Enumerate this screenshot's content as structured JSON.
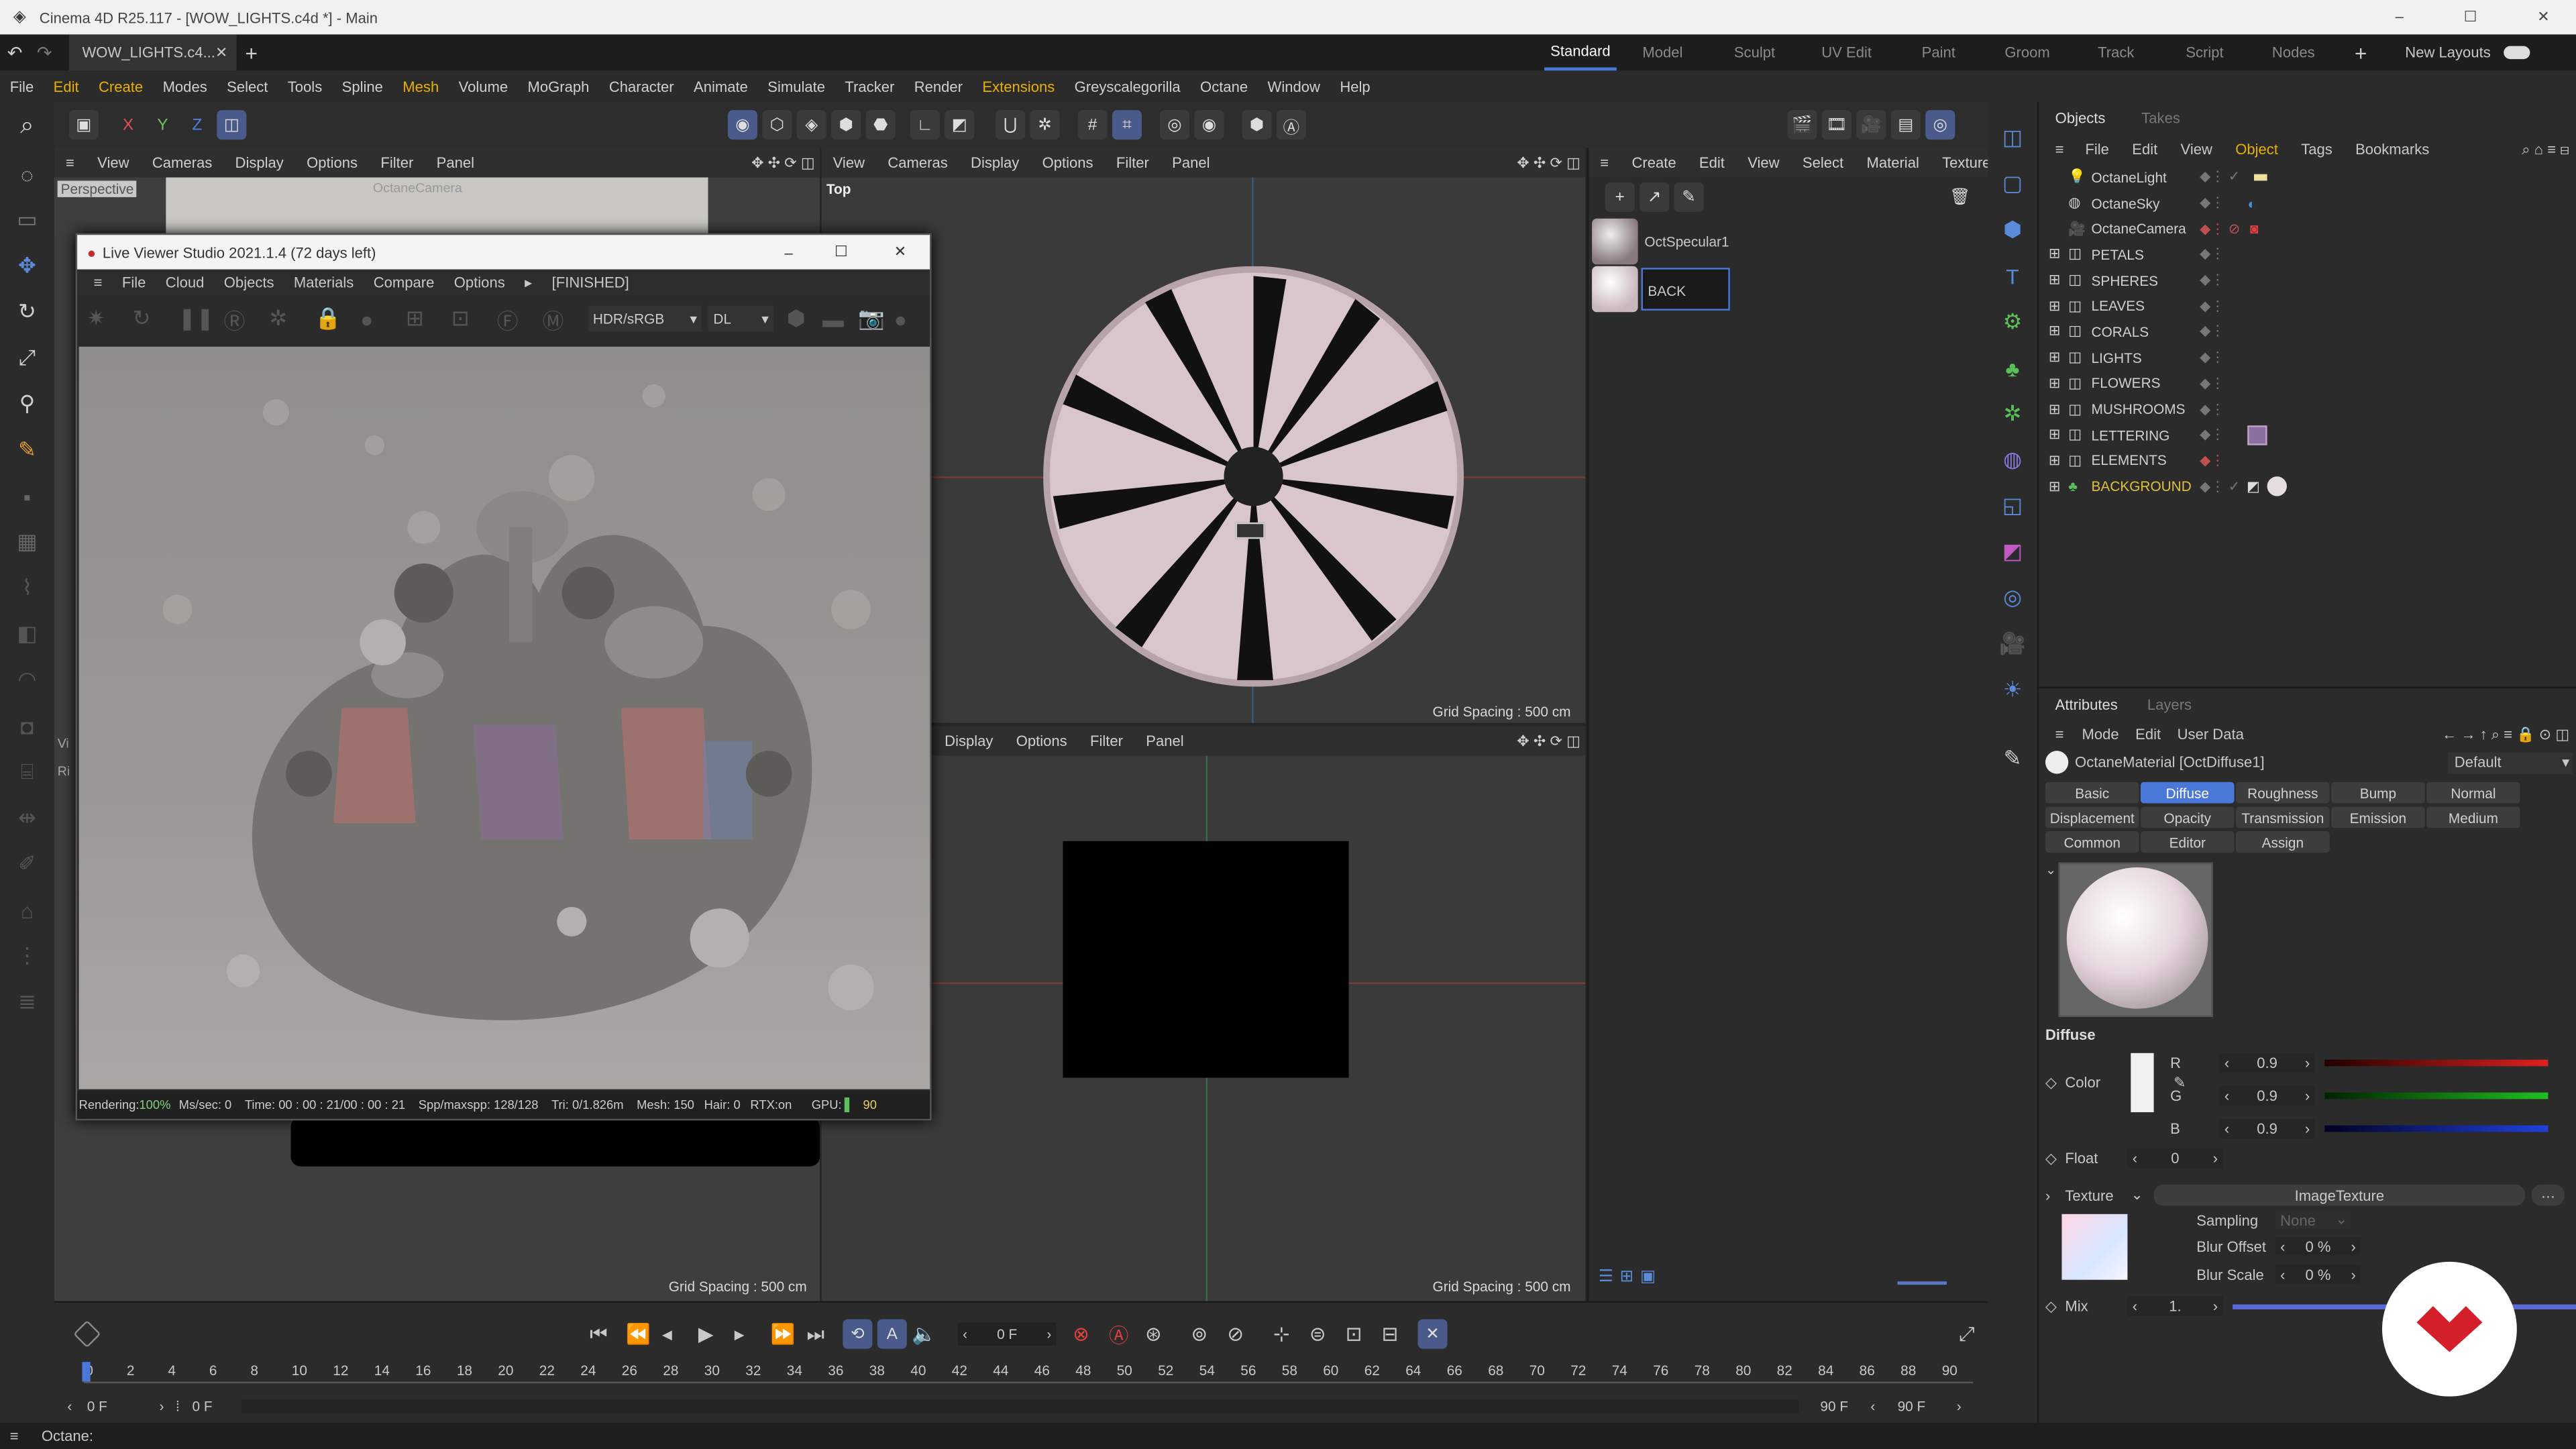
{
  "window": {
    "title": "Cinema 4D R25.117 - [WOW_LIGHTS.c4d *] - Main"
  },
  "tabs": {
    "doc_tab": "WOW_LIGHTS.c4...",
    "layouts": [
      "Standard",
      "Model",
      "Sculpt",
      "UV Edit",
      "Paint",
      "Groom",
      "Track",
      "Script",
      "Nodes"
    ],
    "new_layouts": "New Layouts"
  },
  "menu": [
    "File",
    "Edit",
    "Create",
    "Modes",
    "Select",
    "Tools",
    "Spline",
    "Mesh",
    "Volume",
    "MoGraph",
    "Character",
    "Animate",
    "Simulate",
    "Tracker",
    "Render",
    "Extensions",
    "Greyscalegorilla",
    "Octane",
    "Window",
    "Help"
  ],
  "coords": {
    "x": "X",
    "y": "Y",
    "z": "Z"
  },
  "viewport_menu": [
    "View",
    "Cameras",
    "Display",
    "Options",
    "Filter",
    "Panel"
  ],
  "viewport_tl": {
    "name": "Perspective",
    "camera": "OctaneCamera"
  },
  "viewport_tr": {
    "name": "Top",
    "grid": "Grid Spacing : 500 cm"
  },
  "viewport_br": {
    "menu": [
      "Display",
      "Options",
      "Filter",
      "Panel"
    ],
    "grid": "Grid Spacing : 500 cm"
  },
  "viewport_bl": {
    "label_vi": "Vi",
    "label_ri": "Ri",
    "grid": "Grid Spacing : 500 cm"
  },
  "live_viewer": {
    "title": "Live Viewer Studio 2021.1.4 (72 days left)",
    "menu": [
      "File",
      "Cloud",
      "Objects",
      "Materials",
      "Compare",
      "Options"
    ],
    "state": "[FINISHED]",
    "colorspace": "HDR/sRGB",
    "kernel": "DL",
    "status": {
      "rendering": "Rendering: ",
      "rendering_val": "100%",
      "mssec": "Ms/sec: 0",
      "time": "Time: 00 : 00 : 21/00 : 00 : 21",
      "spp": "Spp/maxspp: 128/128",
      "tri": "Tri: 0/1.826m",
      "mesh": "Mesh: 150",
      "hair": "Hair: 0",
      "rtx": "RTX:on",
      "gpu": "GPU:",
      "gpu_val": "90"
    }
  },
  "material_panel": {
    "menu": [
      "Create",
      "Edit",
      "View",
      "Select",
      "Material",
      "Texture"
    ],
    "materials": [
      {
        "name": "OctSpecular1"
      },
      {
        "name": "BACK"
      }
    ]
  },
  "objects_panel": {
    "tabs": [
      "Objects",
      "Takes"
    ],
    "menu": [
      "File",
      "Edit",
      "View",
      "Object",
      "Tags",
      "Bookmarks"
    ],
    "items": [
      {
        "name": "OctaneLight",
        "color": "#d6d6d6"
      },
      {
        "name": "OctaneSky",
        "color": "#d6d6d6"
      },
      {
        "name": "OctaneCamera",
        "color": "#d6d6d6"
      },
      {
        "name": "PETALS",
        "color": "#d6d6d6"
      },
      {
        "name": "SPHERES",
        "color": "#d6d6d6"
      },
      {
        "name": "LEAVES",
        "color": "#d6d6d6"
      },
      {
        "name": "CORALS",
        "color": "#d6d6d6"
      },
      {
        "name": "LIGHTS",
        "color": "#d6d6d6"
      },
      {
        "name": "FLOWERS",
        "color": "#d6d6d6"
      },
      {
        "name": "MUSHROOMS",
        "color": "#d6d6d6"
      },
      {
        "name": "LETTERING",
        "color": "#d6d6d6"
      },
      {
        "name": "ELEMENTS",
        "color": "#d6d6d6"
      },
      {
        "name": "BACKGROUND",
        "color": "#e0c040"
      }
    ]
  },
  "attributes": {
    "tabs": [
      "Attributes",
      "Layers"
    ],
    "menu": [
      "Mode",
      "Edit",
      "User Data"
    ],
    "material_name": "OctaneMaterial [OctDiffuse1]",
    "preset": "Default",
    "channel_tabs": [
      [
        "Basic",
        "Diffuse",
        "Roughness",
        "Bump",
        "Normal"
      ],
      [
        "Displacement",
        "Opacity",
        "Transmission",
        "Emission",
        "Medium"
      ],
      [
        "Common",
        "Editor",
        "Assign"
      ]
    ],
    "selected_tab": "Diffuse",
    "section": "Diffuse",
    "color_label": "Color",
    "r_label": "R",
    "r": "0.9",
    "g_label": "G",
    "g": "0.9",
    "b_label": "B",
    "b": "0.9",
    "float_label": "Float",
    "float": "0",
    "texture_label": "Texture",
    "texture_value": "ImageTexture",
    "sampling_label": "Sampling",
    "sampling": "None",
    "blur_offset_label": "Blur Offset",
    "blur_offset": "0 %",
    "blur_scale_label": "Blur Scale",
    "blur_scale": "0 %",
    "mix_label": "Mix",
    "mix": "1."
  },
  "timeline": {
    "ticks": [
      "0",
      "2",
      "4",
      "6",
      "8",
      "10",
      "12",
      "14",
      "16",
      "18",
      "20",
      "22",
      "24",
      "26",
      "28",
      "30",
      "32",
      "34",
      "36",
      "38",
      "40",
      "42",
      "44",
      "46",
      "48",
      "50",
      "52",
      "54",
      "56",
      "58",
      "60",
      "62",
      "64",
      "66",
      "68",
      "70",
      "72",
      "74",
      "76",
      "78",
      "80",
      "82",
      "84",
      "86",
      "88",
      "90"
    ],
    "current_frame": "0 F",
    "start": "0 F",
    "start2": "0 F",
    "end": "90 F",
    "end2": "90 F"
  },
  "status": {
    "text": "Octane:"
  },
  "colors": {
    "accent": "#4a78d8",
    "highlight": "#e8b000",
    "brand": "#d41f2a"
  }
}
